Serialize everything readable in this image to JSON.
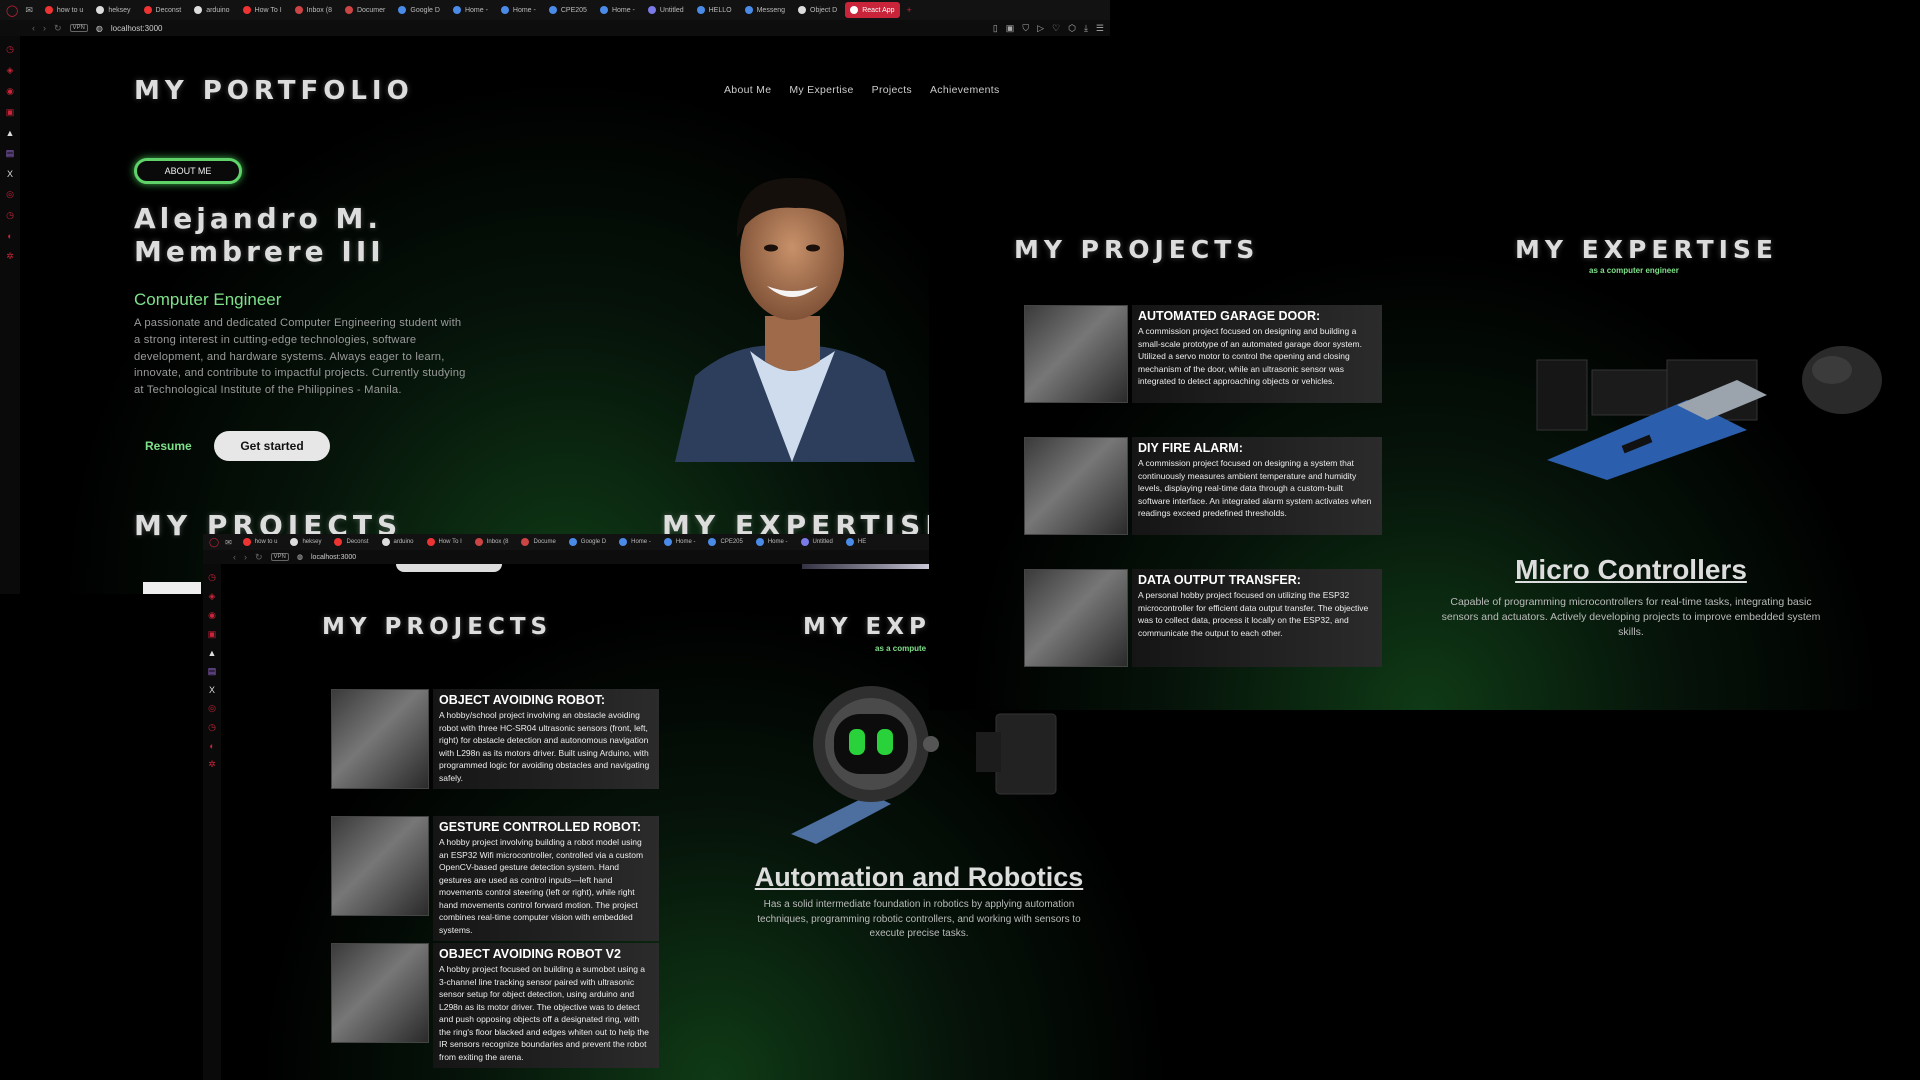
{
  "browser": {
    "tabs": [
      {
        "label": "how to u",
        "color": "#e33"
      },
      {
        "label": "heksey",
        "color": "#ddd"
      },
      {
        "label": "Deconst",
        "color": "#e33"
      },
      {
        "label": "arduino",
        "color": "#ddd"
      },
      {
        "label": "How To I",
        "color": "#e33"
      },
      {
        "label": "Inbox (8",
        "color": "#c44"
      },
      {
        "label": "Documer",
        "color": "#c44"
      },
      {
        "label": "Google D",
        "color": "#4a8be8"
      },
      {
        "label": "Home -",
        "color": "#4a8be8"
      },
      {
        "label": "Home -",
        "color": "#4a8be8"
      },
      {
        "label": "CPE205",
        "color": "#4a8be8"
      },
      {
        "label": "Home -",
        "color": "#4a8be8"
      },
      {
        "label": "Untitled",
        "color": "#7a7ae8"
      },
      {
        "label": "HELLO",
        "color": "#4a8be8"
      },
      {
        "label": "Messeng",
        "color": "#4a8be8"
      },
      {
        "label": "Object D",
        "color": "#ddd"
      },
      {
        "label": "React App",
        "color": "#fff",
        "active": true
      }
    ],
    "tabs_small": [
      {
        "label": "how to u",
        "color": "#e33"
      },
      {
        "label": "heksey",
        "color": "#ddd"
      },
      {
        "label": "Deconst",
        "color": "#e33"
      },
      {
        "label": "arduino",
        "color": "#ddd"
      },
      {
        "label": "How To I",
        "color": "#e33"
      },
      {
        "label": "Inbox (8",
        "color": "#c44"
      },
      {
        "label": "Docume",
        "color": "#c44"
      },
      {
        "label": "Google D",
        "color": "#4a8be8"
      },
      {
        "label": "Home -",
        "color": "#4a8be8"
      },
      {
        "label": "Home -",
        "color": "#4a8be8"
      },
      {
        "label": "CPE205",
        "color": "#4a8be8"
      },
      {
        "label": "Home -",
        "color": "#4a8be8"
      },
      {
        "label": "Untitled",
        "color": "#7a7ae8"
      },
      {
        "label": "HE",
        "color": "#4a8be8"
      }
    ],
    "url": "localhost:3000",
    "vpn": "VPN"
  },
  "site": {
    "logo": "MY PORTFOLIO",
    "nav": [
      "About Me",
      "My Expertise",
      "Projects",
      "Achievements"
    ],
    "about_pill": "ABOUT ME",
    "name_line1": "Alejandro M.",
    "name_line2": "Membrere III",
    "role": "Computer Engineer",
    "bio": "A passionate and dedicated Computer Engineering student with a strong interest in cutting-edge technologies, software development, and hardware systems. Always eager to learn, innovate, and contribute to impactful projects. Currently studying at Technological Institute of the Philippines - Manila.",
    "resume_btn": "Resume",
    "started_btn": "Get started",
    "projects_heading": "MY PROJECTS",
    "expertise_heading": "MY EXPERTISE",
    "expertise_heading_partial": "MY EXP",
    "expertise_sub": "as a computer engineer",
    "expertise_sub_partial": "as a compute",
    "projects_a": [
      {
        "title": "AUTOMATED GARAGE DOOR:",
        "desc": "A commission project focused on designing and building a small-scale prototype of an automated garage door system. Utilized a servo motor to control the opening and closing mechanism of the door, while an ultrasonic sensor was integrated to detect approaching objects or vehicles."
      },
      {
        "title": "DIY FIRE ALARM:",
        "desc": "A commission project focused on designing a system that continuously measures ambient temperature and humidity levels, displaying real-time data through a custom-built software interface. An integrated alarm system activates when readings exceed predefined thresholds."
      },
      {
        "title": "DATA OUTPUT TRANSFER:",
        "desc": "A personal hobby project focused on utilizing the ESP32 microcontroller for efficient data output transfer. The objective was to collect data, process it locally on the ESP32, and communicate the output to each other."
      }
    ],
    "projects_b": [
      {
        "title": "OBJECT AVOIDING ROBOT:",
        "desc": "A hobby/school project involving an obstacle avoiding robot with three HC-SR04 ultrasonic sensors (front, left, right) for obstacle detection and autonomous navigation with L298n as its motors driver. Built using Arduino, with programmed logic for avoiding obstacles and navigating safely."
      },
      {
        "title": "GESTURE CONTROLLED ROBOT:",
        "desc": "A hobby project involving building a robot model using an ESP32 Wifi microcontroller, controlled via a custom OpenCV-based gesture detection system. Hand gestures are used as control inputs—left hand movements control steering (left or right), while right hand movements control forward motion. The project combines real-time computer vision with embedded systems."
      },
      {
        "title": "OBJECT AVOIDING ROBOT V2",
        "desc": "A hobby project focused on building a sumobot using a 3-channel line tracking sensor paired with ultrasonic sensor setup for object detection, using arduino and L298n as its motor driver. The objective was to detect and push opposing objects off a designated ring, with the ring's floor blacked and edges whiten out to help the IR sensors recognize boundaries and prevent the robot from exiting the arena."
      }
    ],
    "expertise_micro": {
      "title": "Micro Controllers",
      "desc": "Capable of programming microcontrollers for real-time tasks, integrating basic sensors and actuators. Actively developing projects to improve embedded system skills."
    },
    "expertise_robot": {
      "title": "Automation and Robotics",
      "desc": "Has a solid intermediate foundation in robotics by applying automation techniques, programming robotic controllers, and working with sensors to execute precise tasks."
    }
  },
  "colors": {
    "accent_green": "#5fd36a",
    "browser_red": "#c9243a"
  }
}
